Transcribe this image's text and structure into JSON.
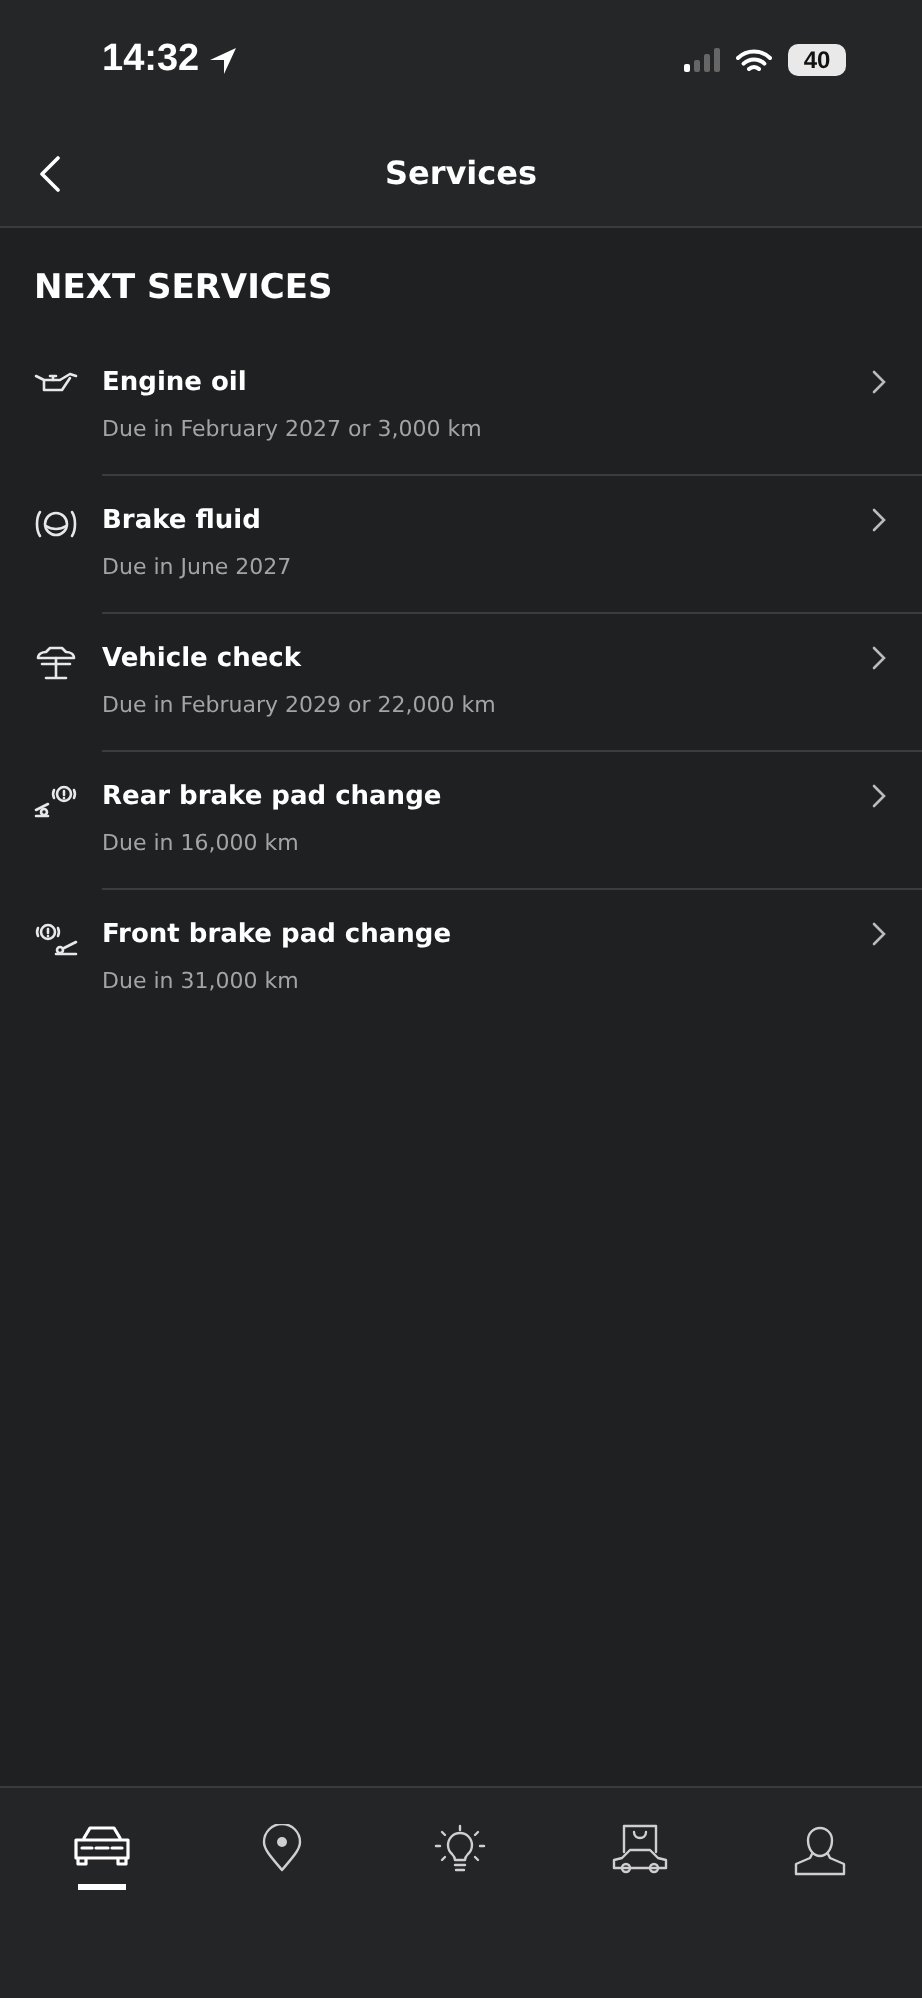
{
  "status_bar": {
    "time": "14:32",
    "battery": "40"
  },
  "header": {
    "title": "Services"
  },
  "section_title": "NEXT SERVICES",
  "services": [
    {
      "kind": "oil",
      "title": "Engine oil",
      "due": "Due in February 2027 or 3,000 km"
    },
    {
      "kind": "fluid",
      "title": "Brake fluid",
      "due": "Due in June 2027"
    },
    {
      "kind": "lift",
      "title": "Vehicle check",
      "due": "Due in February 2029 or 22,000 km"
    },
    {
      "kind": "rear_pad",
      "title": "Rear brake pad change",
      "due": "Due in 16,000 km"
    },
    {
      "kind": "front_pad",
      "title": "Front brake pad change",
      "due": "Due in 31,000 km"
    }
  ],
  "tab_bar": [
    {
      "kind": "car",
      "selected": true
    },
    {
      "kind": "map",
      "selected": false
    },
    {
      "kind": "idea",
      "selected": false
    },
    {
      "kind": "shop",
      "selected": false
    },
    {
      "kind": "profile",
      "selected": false
    }
  ]
}
